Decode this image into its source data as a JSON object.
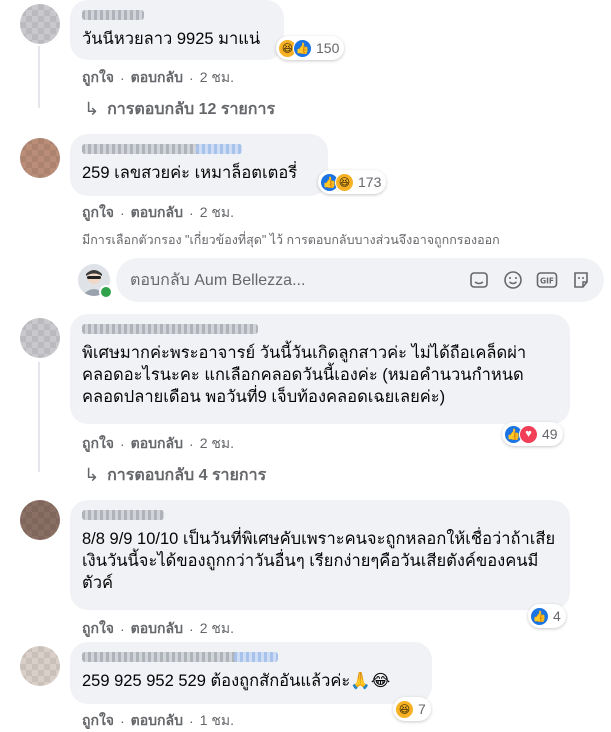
{
  "comments": [
    {
      "text": "วันนีหวยลาว 9925 มาแน่",
      "reaction_count": "150",
      "reactions": [
        "haha-icon",
        "like-icon"
      ],
      "actions": {
        "like": "ถูกใจ",
        "reply": "ตอบกลับ",
        "sep": "·",
        "time": "2 ชม."
      },
      "replies_label": "การตอบกลับ 12 รายการ"
    },
    {
      "text": "259 เลขสวยค่ะ เหมาล็อตเตอรี่",
      "reaction_count": "173",
      "reactions": [
        "like-icon",
        "haha-icon"
      ],
      "actions": {
        "like": "ถูกใจ",
        "reply": "ตอบกลับ",
        "sep": "·",
        "time": "2 ชม."
      },
      "notice": "มีการเลือกตัวกรอง \"เกี่ยวข้องที่สุด\" ไว้ การตอบกลับบางส่วนจึงอาจถูกกรองออก"
    },
    {
      "text": "พิเศษมากค่ะพระอาจารย์ วันนี้วันเกิดลูกสาวค่ะ ไม่ได้ถือเคล็ดผ่าคลอดอะไรนะคะ แกเลือกคลอดวันนี้เองค่ะ (หมอคำนวนกำหนดคลอดปลายเดือน พอวันที่9 เจ็บท้องคลอดเฉยเลยค่ะ)",
      "reaction_count": "49",
      "reactions": [
        "like-icon",
        "love-icon"
      ],
      "actions": {
        "like": "ถูกใจ",
        "reply": "ตอบกลับ",
        "sep": "·",
        "time": "2 ชม."
      },
      "replies_label": "การตอบกลับ 4 รายการ"
    },
    {
      "text": "8/8 9/9 10/10 เป็นวันที่พิเศษคับเพราะคนจะถูกหลอกให้เชื่อว่าถ้าเสียเงินวันนี้จะได้ของถูกกว่าวันอื่นๆ เรียกง่ายๆคือวันเสียตังค์ของคนมีตัวค์",
      "reaction_count": "4",
      "reactions": [
        "like-icon"
      ],
      "actions": {
        "like": "ถูกใจ",
        "reply": "ตอบกลับ",
        "sep": "·",
        "time": "2 ชม."
      }
    },
    {
      "text": "259 925 952 529 ต้องถูกสักอันแล้วค่ะ🙏😂",
      "reaction_count": "7",
      "reactions": [
        "haha-icon"
      ],
      "actions": {
        "like": "ถูกใจ",
        "reply": "ตอบกลับ",
        "sep": "·",
        "time": "1 ชม."
      }
    }
  ],
  "reply_box": {
    "placeholder": "ตอบกลับ Aum Bellezza...",
    "tools": [
      "sticker-icon",
      "emoji-icon",
      "gif-icon",
      "sticker-alt-icon"
    ]
  },
  "colors": {
    "like": "#1b74e4",
    "haha": "#f7b125",
    "love": "#f33e58",
    "bubble": "#f0f2f5",
    "meta_text": "#65676b"
  }
}
